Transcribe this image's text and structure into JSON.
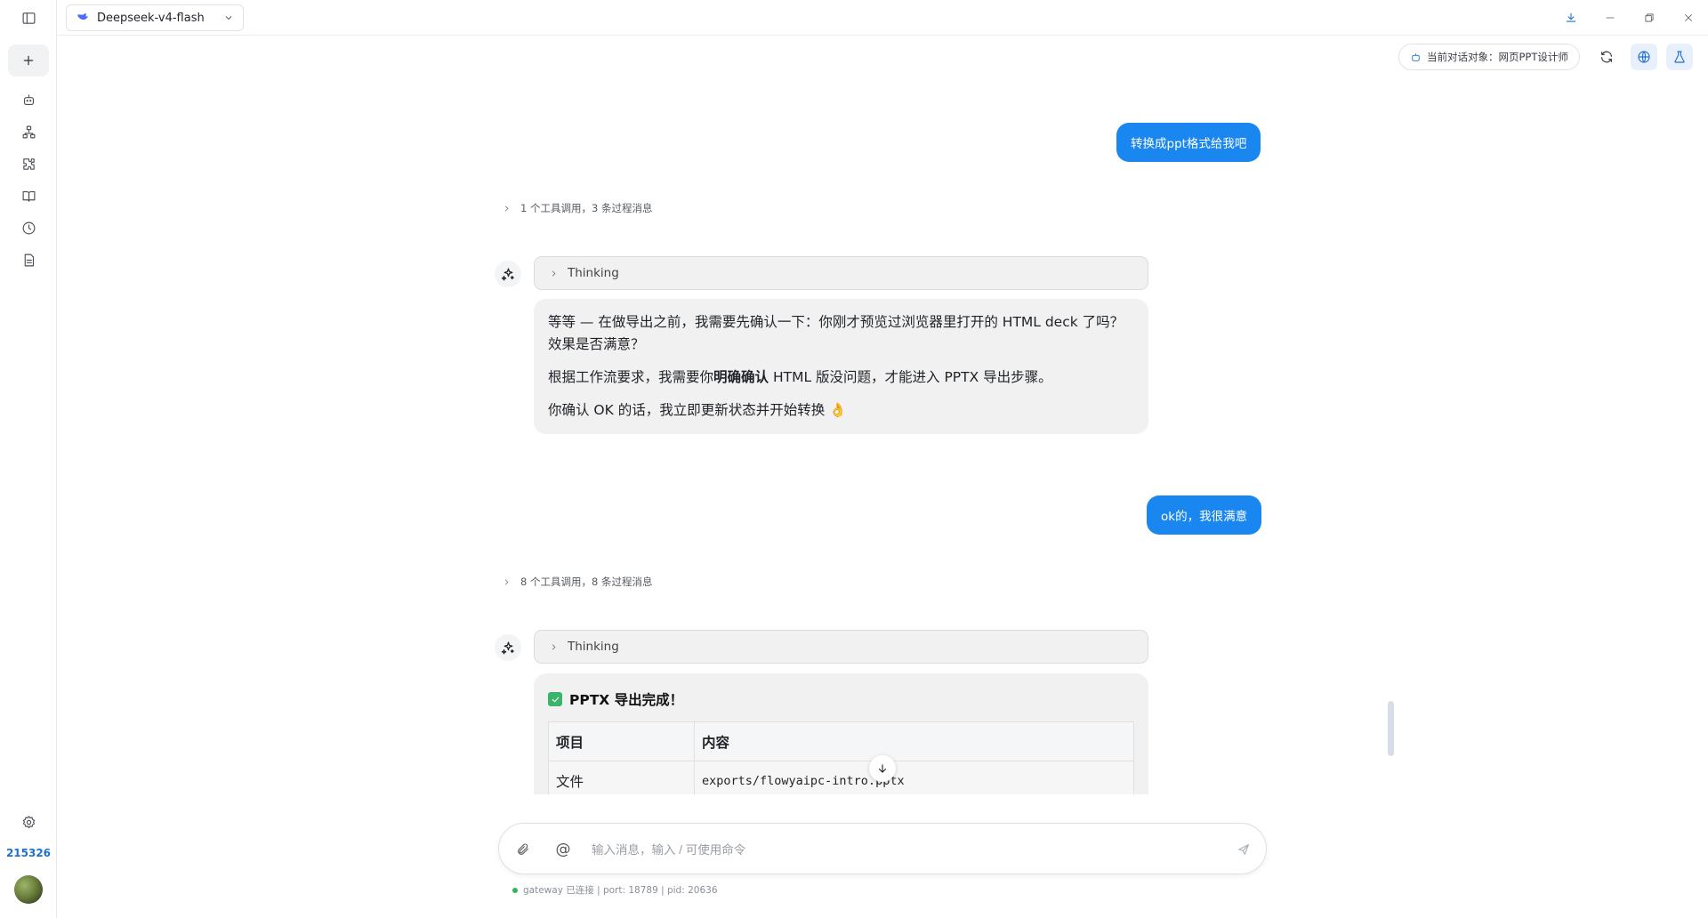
{
  "topbar": {
    "model_name": "Deepseek-v4-flash"
  },
  "header": {
    "target_label": "当前对话对象：网页PPT设计师"
  },
  "sidebar": {
    "items": [
      {
        "icon": "bot-icon"
      },
      {
        "icon": "workflow-icon"
      },
      {
        "icon": "puzzle-icon"
      },
      {
        "icon": "book-icon"
      },
      {
        "icon": "clock-icon"
      },
      {
        "icon": "document-icon"
      }
    ],
    "user_id": "215326"
  },
  "chat": {
    "user_msg_1": "转换成ppt格式给我吧",
    "tools_summary_1": "1 个工具调用，3 条过程消息",
    "thinking_label_1": "Thinking",
    "bot_msg_1_line_1": "等等 — 在做导出之前，我需要先确认一下：你刚才预览过浏览器里打开的 HTML deck 了吗？效果是否满意？",
    "bot_msg_1_line_2_a": "根据工作流要求，我需要你",
    "bot_msg_1_line_2_bold": "明确确认",
    "bot_msg_1_line_2_b": " HTML 版没问题，才能进入 PPTX 导出步骤。",
    "bot_msg_1_line_3": "你确认 OK 的话，我立即更新状态并开始转换 👌",
    "user_msg_2": "ok的，我很满意",
    "tools_summary_2": "8 个工具调用，8 条过程消息",
    "thinking_label_2": "Thinking",
    "export_title": "PPTX 导出完成！",
    "table": {
      "headers": [
        "项目",
        "内容"
      ],
      "rows": [
        [
          "文件",
          "exports/flowyaipc-intro.pptx"
        ]
      ]
    }
  },
  "input": {
    "placeholder": "输入消息，输入 / 可使用命令",
    "value": ""
  },
  "status_bar": {
    "text": "gateway 已连接 | port: 18789 | pid: 20636"
  },
  "colors": {
    "accent": "#1a86f0",
    "status_ok": "#2fb55d"
  }
}
